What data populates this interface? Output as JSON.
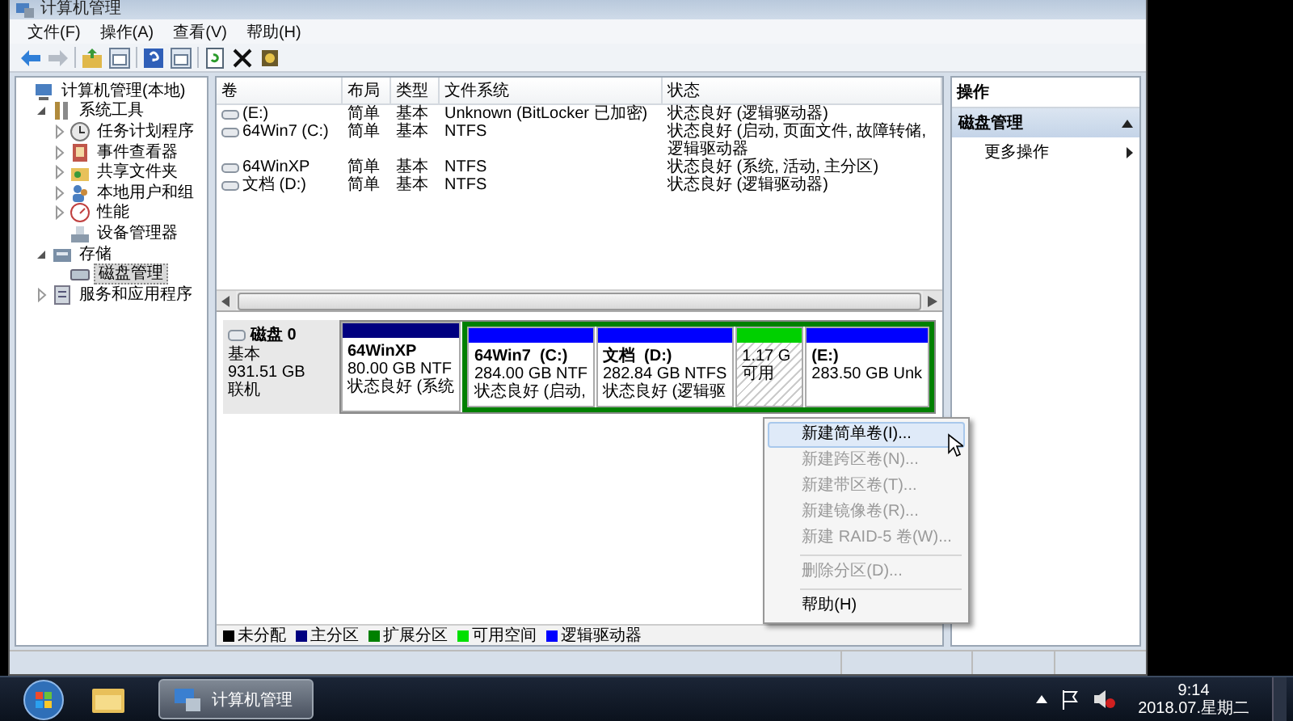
{
  "window": {
    "title": "计算机管理"
  },
  "menu_bar": [
    "文件(F)",
    "操作(A)",
    "查看(V)",
    "帮助(H)"
  ],
  "tree": [
    {
      "label": "计算机管理(本地)",
      "kind": "computer",
      "selected": false,
      "children": [
        {
          "label": "系统工具",
          "kind": "tools",
          "expanded": true,
          "selected": false,
          "children": [
            {
              "label": "任务计划程序",
              "kind": "clock",
              "expanded": false,
              "selected": false
            },
            {
              "label": "事件查看器",
              "kind": "log",
              "expanded": false,
              "selected": false
            },
            {
              "label": "共享文件夹",
              "kind": "share",
              "expanded": false,
              "selected": false
            },
            {
              "label": "本地用户和组",
              "kind": "users",
              "expanded": false,
              "selected": false
            },
            {
              "label": "性能",
              "kind": "perf",
              "expanded": false,
              "selected": false
            },
            {
              "label": "设备管理器",
              "kind": "device",
              "selected": false
            }
          ]
        },
        {
          "label": "存储",
          "kind": "storage",
          "expanded": true,
          "selected": false,
          "children": [
            {
              "label": "磁盘管理",
              "kind": "disk",
              "selected": true
            }
          ]
        },
        {
          "label": "服务和应用程序",
          "kind": "services",
          "expanded": false,
          "selected": false
        }
      ]
    }
  ],
  "volumes": {
    "columns": [
      "卷",
      "布局",
      "类型",
      "文件系统",
      "状态"
    ],
    "rows": [
      {
        "volume": "(E:)",
        "layout": "简单",
        "type": "基本",
        "file_system": "Unknown (BitLocker 已加密)",
        "status": "状态良好 (逻辑驱动器)"
      },
      {
        "volume": "64Win7  (C:)",
        "layout": "简单",
        "type": "基本",
        "file_system": "NTFS",
        "status": "状态良好 (启动, 页面文件, 故障转储, 逻辑驱动器"
      },
      {
        "volume": "64WinXP",
        "layout": "简单",
        "type": "基本",
        "file_system": "NTFS",
        "status": "状态良好 (系统, 活动, 主分区)"
      },
      {
        "volume": "文档 (D:)",
        "layout": "简单",
        "type": "基本",
        "file_system": "NTFS",
        "status": "状态良好 (逻辑驱动器)"
      }
    ]
  },
  "disk": {
    "name": "磁盘 0",
    "type": "基本",
    "size": "931.51 GB",
    "state": "联机",
    "partitions": [
      {
        "kind": "primary",
        "name": "64WinXP",
        "size": "80.00 GB NTF",
        "status": "状态良好 (系统"
      },
      {
        "kind": "extended",
        "children": [
          {
            "kind": "logical",
            "name": "64Win7  (C:)",
            "size": "284.00 GB NTF",
            "status": "状态良好 (启动,"
          },
          {
            "kind": "logical",
            "name": "文档  (D:)",
            "size": "282.84 GB NTFS",
            "status": "状态良好 (逻辑驱"
          },
          {
            "kind": "free",
            "size": "1.17 G",
            "status": "可用"
          },
          {
            "kind": "logical",
            "name": "(E:)",
            "size": "283.50 GB Unk"
          }
        ]
      }
    ]
  },
  "legend": [
    {
      "label": "未分配",
      "color": "#000000"
    },
    {
      "label": "主分区",
      "color": "#000080"
    },
    {
      "label": "扩展分区",
      "color": "#008000"
    },
    {
      "label": "可用空间",
      "color": "#00e000"
    },
    {
      "label": "逻辑驱动器",
      "color": "#0000ff"
    }
  ],
  "actions": {
    "title": "操作",
    "section": "磁盘管理",
    "items": [
      "更多操作"
    ]
  },
  "context_menu": {
    "groups": [
      [
        {
          "label": "新建简单卷(I)...",
          "disabled": false,
          "selected": true
        },
        {
          "label": "新建跨区卷(N)...",
          "disabled": true,
          "selected": false
        },
        {
          "label": "新建带区卷(T)...",
          "disabled": true,
          "selected": false
        },
        {
          "label": "新建镜像卷(R)...",
          "disabled": true,
          "selected": false
        },
        {
          "label": "新建 RAID-5 卷(W)...",
          "disabled": true,
          "selected": false
        }
      ],
      [
        {
          "label": "删除分区(D)...",
          "disabled": true,
          "selected": false
        }
      ],
      [
        {
          "label": "帮助(H)",
          "disabled": false,
          "selected": false
        }
      ]
    ]
  },
  "taskbar": {
    "tasks": [
      {
        "label": "计算机管理",
        "selected": true
      }
    ],
    "time": "9:14",
    "date": "2018.07.星期二"
  }
}
